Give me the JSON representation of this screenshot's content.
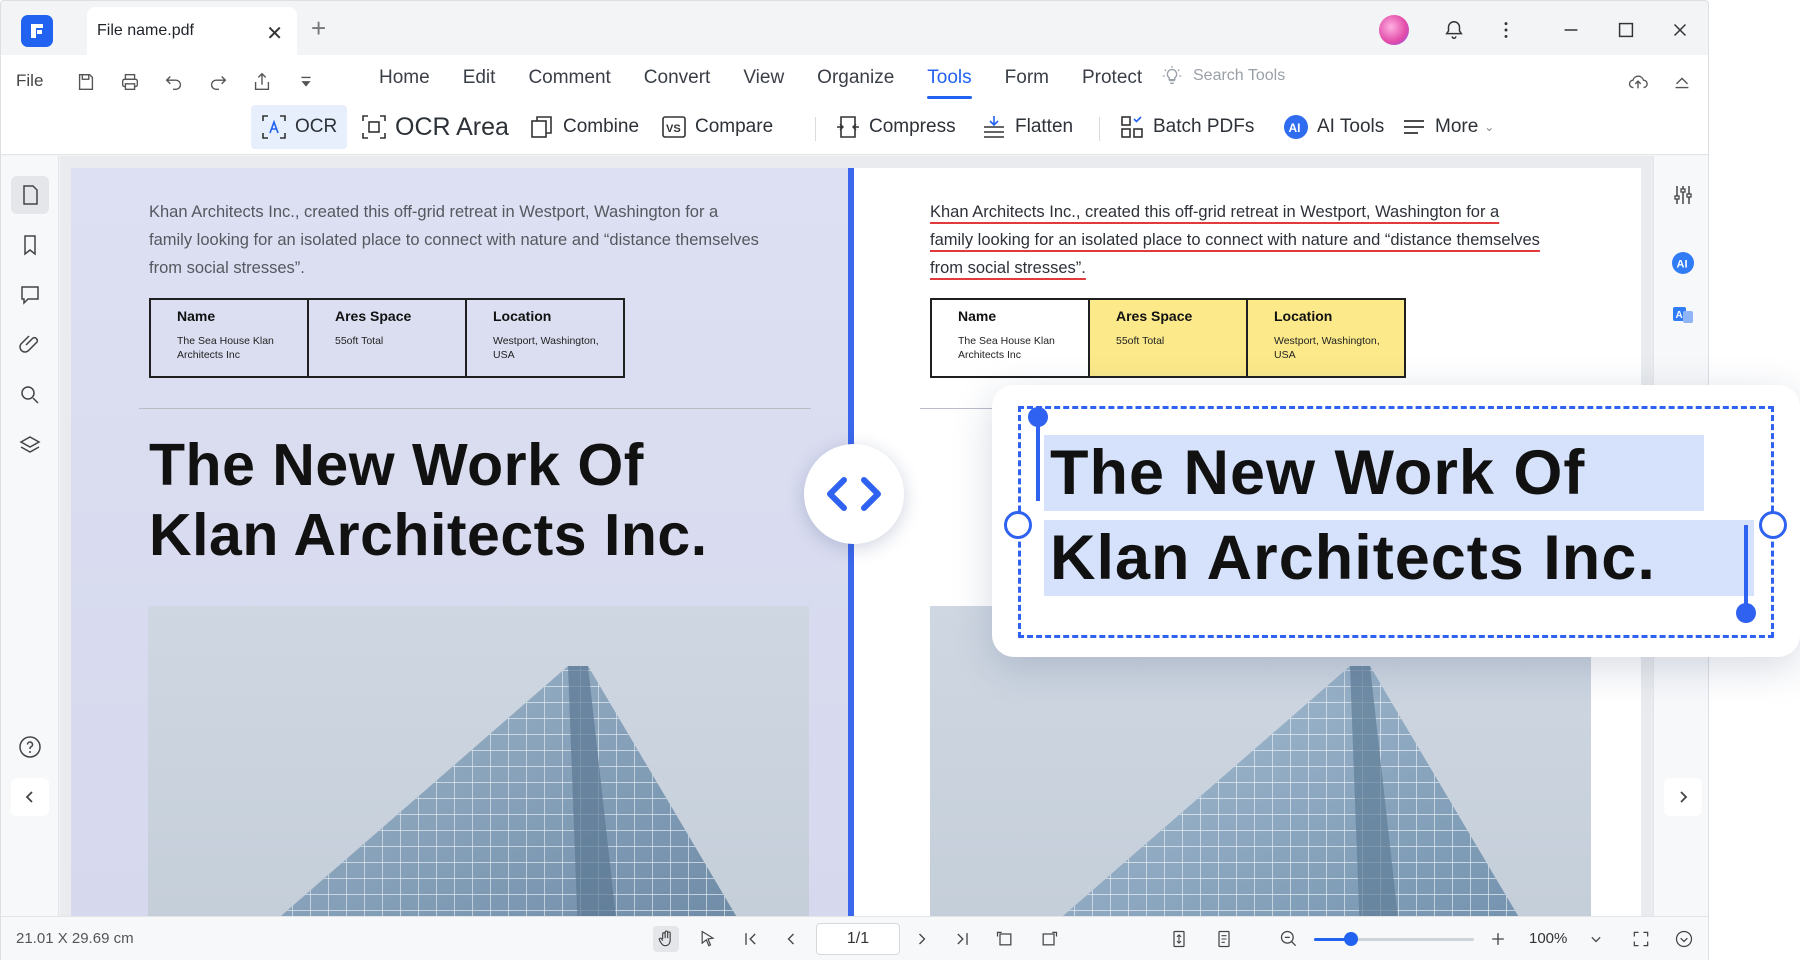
{
  "tab": {
    "title": "File name.pdf"
  },
  "menubar": {
    "file_label": "File",
    "items": [
      "Home",
      "Edit",
      "Comment",
      "Convert",
      "View",
      "Organize",
      "Tools",
      "Form",
      "Protect"
    ],
    "active": "Tools",
    "search_placeholder": "Search Tools"
  },
  "toolbar": {
    "ocr": "OCR",
    "ocr_area": "OCR Area",
    "combine": "Combine",
    "compare": "Compare",
    "compress": "Compress",
    "flatten": "Flatten",
    "batch": "Batch PDFs",
    "ai_tools": "AI Tools",
    "more": "More"
  },
  "document": {
    "paragraph_line1": "Khan Architects Inc., created this off-grid retreat in Westport, Washington for a",
    "paragraph_line2": "family looking for an isolated place to connect with nature and “distance themselves",
    "paragraph_line3": "from social stresses”.",
    "table": {
      "col1_header": "Name",
      "col1_value": "The Sea House Klan Architects Inc",
      "col2_header": "Ares Space",
      "col2_value": "55oft Total",
      "col3_header": "Location",
      "col3_value": "Westport, Washington, USA"
    },
    "headline_line1": "The New Work Of",
    "headline_line2": "Klan Architects Inc."
  },
  "ocr_popup": {
    "line1": "The New Work Of",
    "line2": "Klan Architects Inc."
  },
  "statusbar": {
    "dimensions": "21.01 X 29.69 cm",
    "page": "1/1",
    "zoom": "100%",
    "zoom_level": 0.23
  },
  "colors": {
    "accent": "#2162f0",
    "highlight_yellow": "#fbe98a",
    "underline_red": "#e03a3a"
  }
}
